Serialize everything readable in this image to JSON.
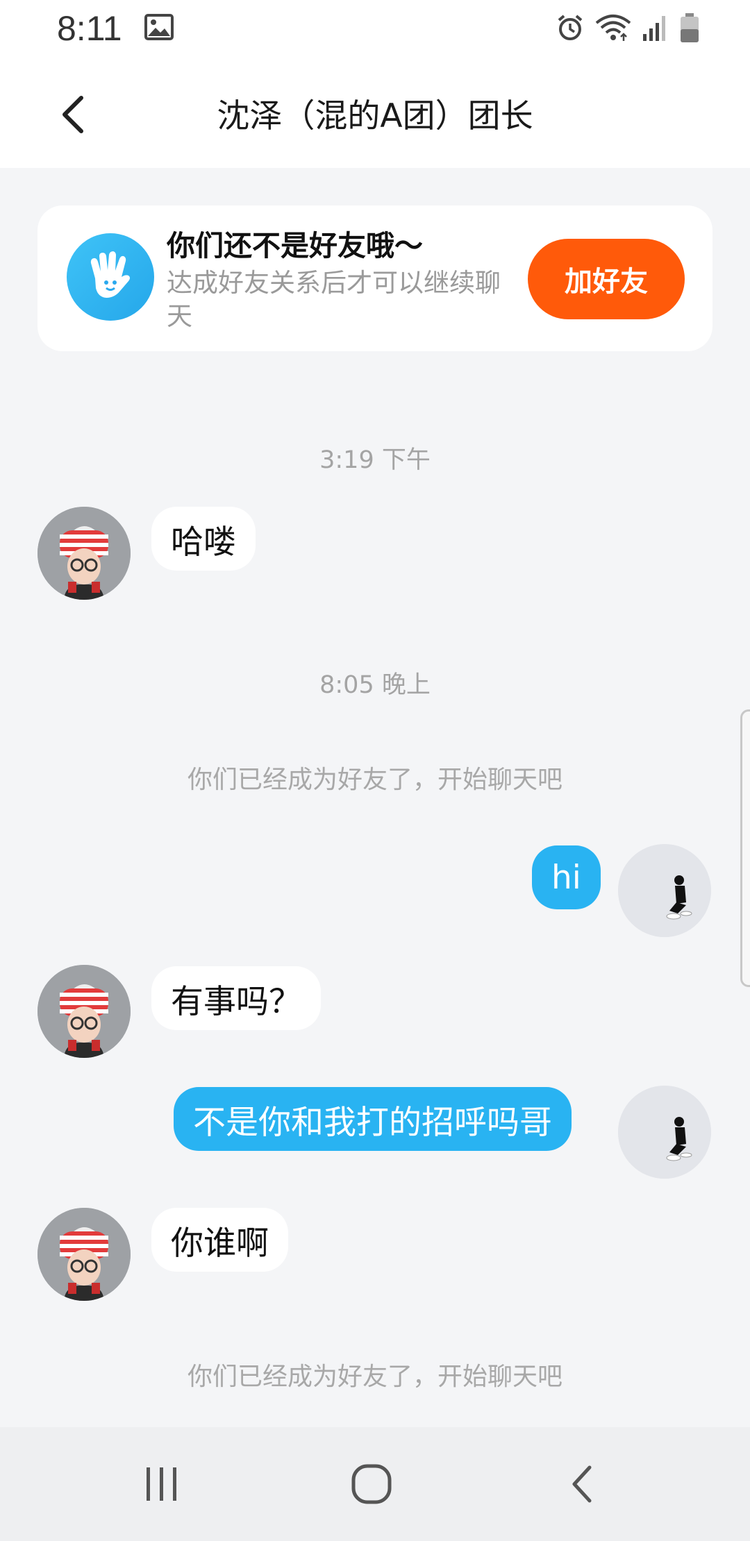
{
  "status_bar": {
    "time": "8:11",
    "icons": [
      "image-icon",
      "alarm-icon",
      "wifi-icon",
      "signal-icon",
      "battery-icon"
    ]
  },
  "header": {
    "title": "沈泽（混的A团）团长",
    "back_icon": "chevron-left-icon"
  },
  "friend_prompt": {
    "icon": "waving-hand-icon",
    "title": "你们还不是好友哦～",
    "subtitle": "达成好友关系后才可以继续聊天",
    "button_label": "加好友"
  },
  "chat": {
    "timestamp_1": "3:19 下午",
    "message_1": "哈喽",
    "timestamp_2": "8:05 晚上",
    "system_note_1": "你们已经成为好友了，开始聊天吧",
    "message_2": "hi",
    "message_3": "有事吗？",
    "message_4": "不是你和我打的招呼吗哥",
    "message_5": "你谁啊",
    "system_note_2": "你们已经成为好友了，开始聊天吧"
  },
  "system_nav": {
    "recents_icon": "recent-apps-icon",
    "home_icon": "home-icon",
    "back_icon": "back-icon"
  },
  "colors": {
    "accent_orange": "#ff5a0a",
    "bubble_blue": "#29b3f2",
    "background": "#f4f5f7"
  }
}
